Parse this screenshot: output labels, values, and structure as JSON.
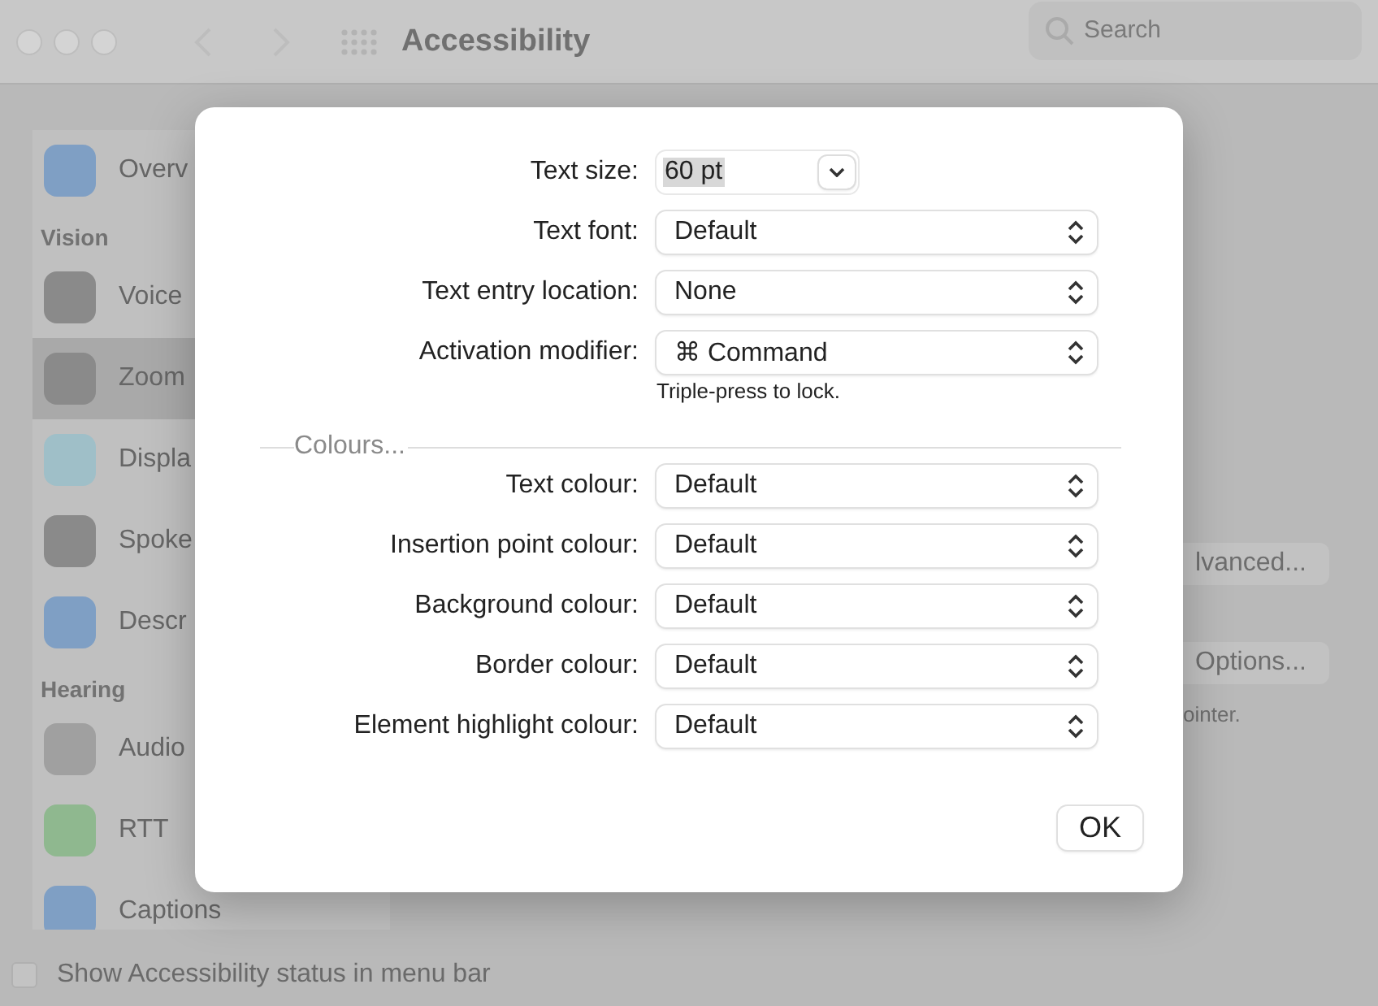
{
  "window": {
    "title": "Accessibility",
    "search": {
      "placeholder": "Search"
    }
  },
  "sidebar": {
    "items": [
      {
        "kind": "item",
        "label": "Overv",
        "selected": false,
        "color": "#7f9fc4"
      },
      {
        "kind": "header",
        "label": "Vision"
      },
      {
        "kind": "item",
        "label": "Voice",
        "selected": false,
        "color": "#8a8a8a"
      },
      {
        "kind": "item",
        "label": "Zoom",
        "selected": true,
        "color": "#8a8a8a"
      },
      {
        "kind": "item",
        "label": "Displa",
        "selected": false,
        "color": "#9fbfc8"
      },
      {
        "kind": "item",
        "label": "Spoke",
        "selected": false,
        "color": "#8a8a8a"
      },
      {
        "kind": "item",
        "label": "Descr",
        "selected": false,
        "color": "#7f9fc4"
      },
      {
        "kind": "header",
        "label": "Hearing"
      },
      {
        "kind": "item",
        "label": "Audio",
        "selected": false,
        "color": "#a0a0a0"
      },
      {
        "kind": "item",
        "label": "RTT",
        "selected": false,
        "color": "#8fb88f"
      },
      {
        "kind": "item",
        "label": "Captions",
        "selected": false,
        "color": "#7f9fc4"
      }
    ]
  },
  "content": {
    "buttons": [
      "lvanced...",
      "Options..."
    ],
    "note": "ointer."
  },
  "footer": {
    "checkbox": {
      "label": "Show Accessibility status in menu bar",
      "checked": false
    }
  },
  "dialog": {
    "rows": [
      {
        "kind": "combo",
        "label": "Text size:",
        "value": "60 pt"
      },
      {
        "kind": "popup",
        "label": "Text font:",
        "value": "Default"
      },
      {
        "kind": "popup",
        "label": "Text entry location:",
        "value": "None"
      },
      {
        "kind": "popup",
        "label": "Activation modifier:",
        "value": "⌘ Command"
      }
    ],
    "note": "Triple-press to lock.",
    "section": "Colours...",
    "colour_rows": [
      {
        "kind": "popup",
        "label": "Text colour:",
        "value": "Default"
      },
      {
        "kind": "popup",
        "label": "Insertion point colour:",
        "value": "Default"
      },
      {
        "kind": "popup",
        "label": "Background colour:",
        "value": "Default"
      },
      {
        "kind": "popup",
        "label": "Border colour:",
        "value": "Default"
      },
      {
        "kind": "popup",
        "label": "Element highlight colour:",
        "value": "Default"
      }
    ],
    "ok": "OK"
  }
}
